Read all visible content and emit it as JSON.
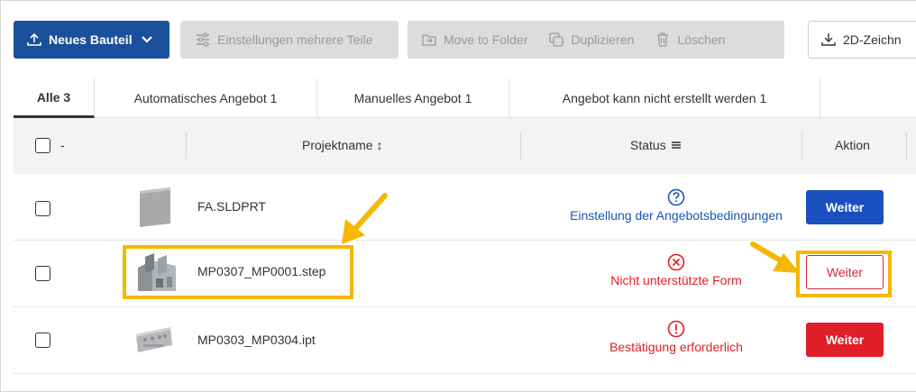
{
  "toolbar": {
    "new_part": "Neues Bauteil",
    "multi_settings": "Einstellungen mehrere Teile",
    "move_to_folder": "Move to Folder",
    "duplicate": "Duplizieren",
    "delete": "Löschen",
    "drawing": "2D-Zeichn"
  },
  "tabs": [
    {
      "label": "Alle 3",
      "active": true
    },
    {
      "label": "Automatisches Angebot 1"
    },
    {
      "label": "Manuelles Angebot 1"
    },
    {
      "label": "Angebot kann nicht erstellt werden 1"
    }
  ],
  "table": {
    "select_all_label": "-",
    "col_project": "Projektname ↕",
    "col_status": "Status",
    "col_action": "Aktion"
  },
  "rows": [
    {
      "name": "FA.SLDPRT",
      "status": "Einstellung der Angebotsbedingungen",
      "status_color": "#1a55b8",
      "action": "Weiter"
    },
    {
      "name": "MP0307_MP0001.step",
      "status": "Nicht unterstützte Form",
      "status_color": "#e01e28",
      "action": "Weiter"
    },
    {
      "name": "MP0303_MP0304.ipt",
      "status": "Bestätigung erforderlich",
      "status_color": "#e01e28",
      "action": "Weiter"
    }
  ],
  "colors": {
    "primary": "#1a4f9c",
    "highlight": "#f5b800",
    "danger": "#e01e28"
  }
}
